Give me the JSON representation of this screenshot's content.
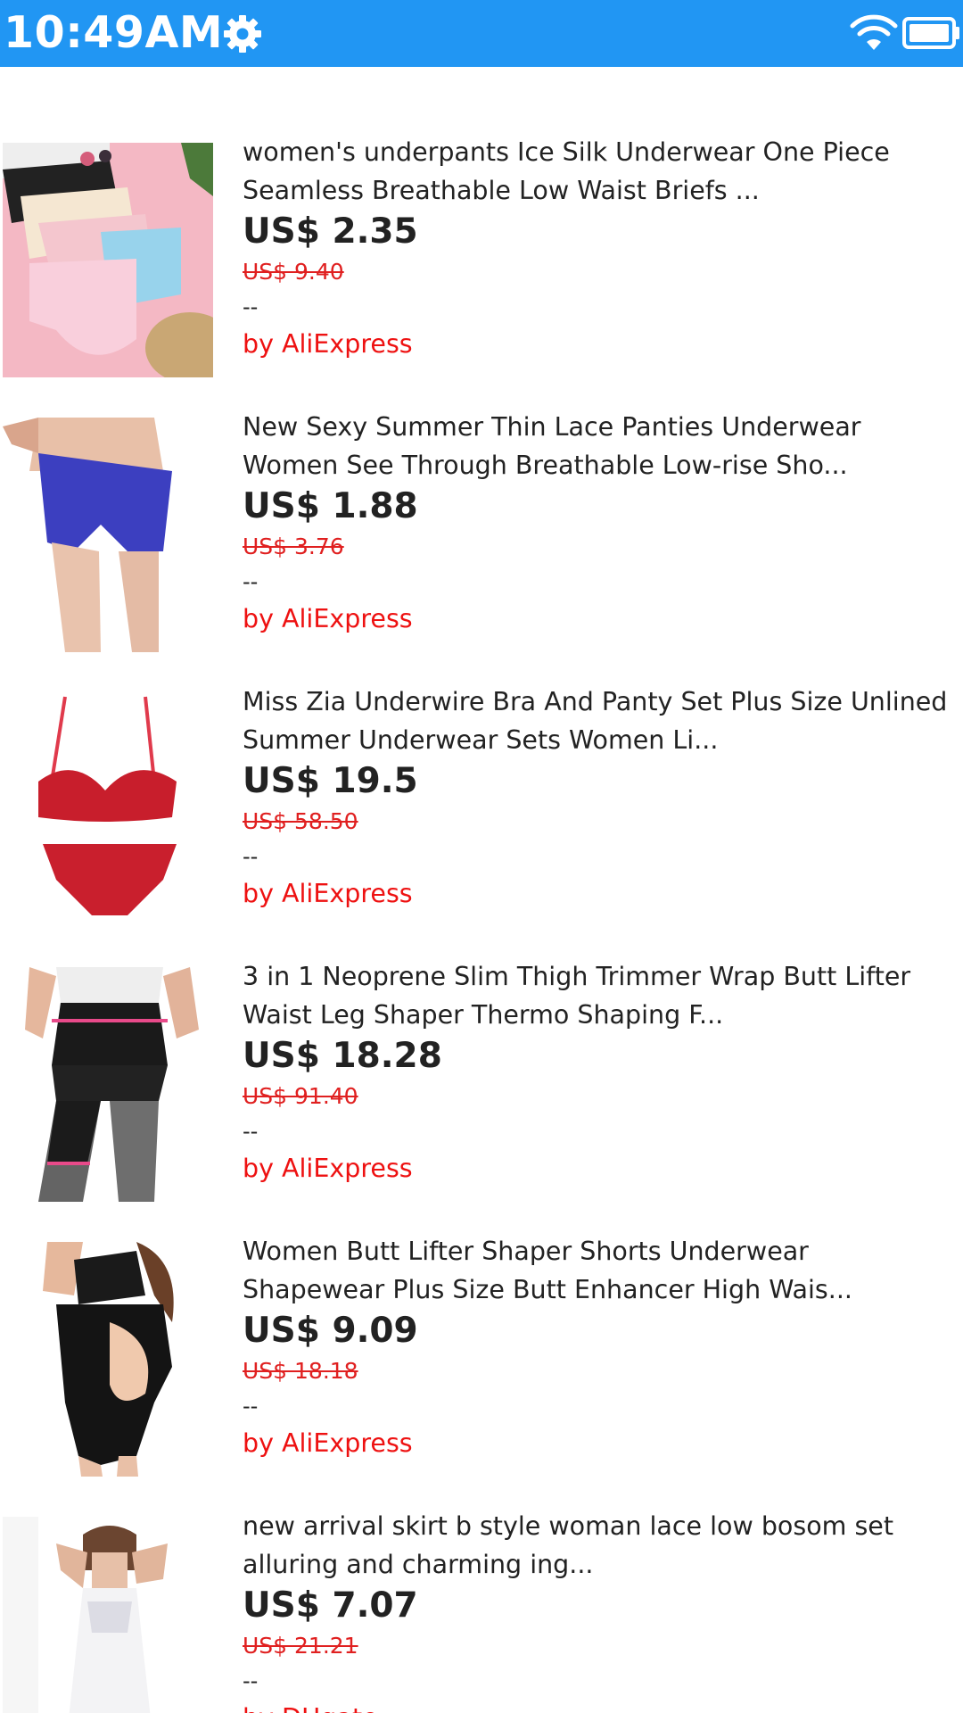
{
  "status_bar": {
    "time": "10:49AM",
    "icons": [
      "gear-icon",
      "wifi-icon",
      "battery-icon"
    ],
    "background_color": "#2196F3"
  },
  "products": [
    {
      "title": "women's underpants Ice Silk Underwear One Piece\nSeamless Breathable Low Waist Briefs ...",
      "price": "US$ 2.35",
      "original_price": "US$ 9.40",
      "rating": "--",
      "seller": "by AliExpress"
    },
    {
      "title": "New Sexy Summer Thin Lace Panties Underwear\nWomen See Through Breathable Low-rise Sho...",
      "price": "US$ 1.88",
      "original_price": "US$ 3.76",
      "rating": "--",
      "seller": "by AliExpress"
    },
    {
      "title": "Miss Zia Underwire Bra And Panty Set Plus Size Unlined\nSummer Underwear Sets Women Li...",
      "price": "US$ 19.5",
      "original_price": "US$ 58.50",
      "rating": "--",
      "seller": "by AliExpress"
    },
    {
      "title": "3 in 1 Neoprene Slim Thigh Trimmer Wrap Butt Lifter\nWaist Leg Shaper Thermo Shaping F...",
      "price": "US$ 18.28",
      "original_price": "US$ 91.40",
      "rating": "--",
      "seller": "by AliExpress"
    },
    {
      "title": "Women Butt Lifter Shaper Shorts Underwear\nShapewear Plus Size Butt Enhancer High Wais...",
      "price": "US$ 9.09",
      "original_price": "US$ 18.18",
      "rating": "--",
      "seller": "by AliExpress"
    },
    {
      "title": "new arrival skirt b style woman lace low bosom set\nalluring and charming ing...",
      "price": "US$ 7.07",
      "original_price": "US$ 21.21",
      "rating": "--",
      "seller": "by DHgate"
    }
  ],
  "colors": {
    "price_text": "#222222",
    "strike_price": "#e02020",
    "seller_text": "#ee1111"
  }
}
